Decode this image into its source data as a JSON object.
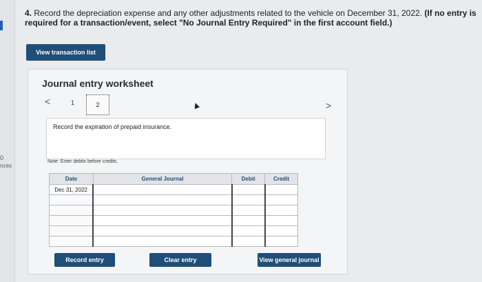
{
  "question": {
    "number": "4.",
    "text": " Record the depreciation expense and any other adjustments related to the vehicle on December 31, 2022. ",
    "instruction": "(If no entry is required for a transaction/event, select \"No Journal Entry Required\" in the first account field.)"
  },
  "sidebar": {
    "partial_label": "nces",
    "partial_number": "0"
  },
  "buttons": {
    "view_transaction_list": "View transaction list",
    "record_entry": "Record entry",
    "clear_entry": "Clear entry",
    "view_general_journal": "View general journal"
  },
  "worksheet": {
    "title": "Journal entry worksheet",
    "pages": [
      "1",
      "2"
    ],
    "prev_icon": "<",
    "next_icon": ">",
    "description": "Record the expiration of prepaid insurance.",
    "note": "Note: Enter debits before credits."
  },
  "journal": {
    "headers": {
      "date": "Date",
      "account": "General Journal",
      "debit": "Debit",
      "credit": "Credit"
    },
    "rows": [
      {
        "date": "Dec 31, 2022",
        "account": "",
        "debit": "",
        "credit": ""
      },
      {
        "date": "",
        "account": "",
        "debit": "",
        "credit": ""
      },
      {
        "date": "",
        "account": "",
        "debit": "",
        "credit": ""
      },
      {
        "date": "",
        "account": "",
        "debit": "",
        "credit": ""
      },
      {
        "date": "",
        "account": "",
        "debit": "",
        "credit": ""
      },
      {
        "date": "",
        "account": "",
        "debit": "",
        "credit": ""
      }
    ]
  },
  "colors": {
    "primary_button": "#1f4e78",
    "background": "#e9ebee"
  }
}
